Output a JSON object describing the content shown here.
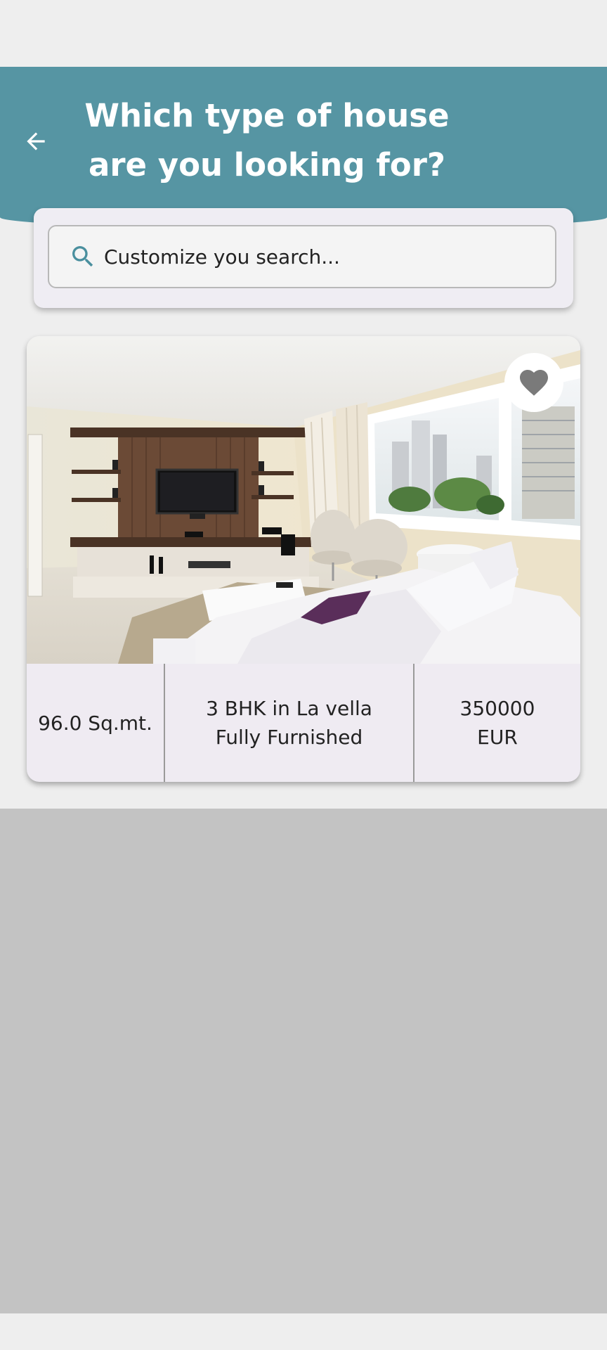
{
  "header": {
    "title_line1": "Which type of house",
    "title_line2": "are you looking for?",
    "back_icon": "arrow-left-icon",
    "color": "#5695a3"
  },
  "search": {
    "placeholder": "Customize you search...",
    "icon": "search-icon",
    "icon_color": "#4a8f9e"
  },
  "listings": [
    {
      "photo": "living-room-photo",
      "favorite_icon": "heart-icon",
      "area": "96.0 Sq.mt.",
      "description": "3 BHK in La vella\nFully Furnished",
      "price": "350000\nEUR"
    }
  ]
}
